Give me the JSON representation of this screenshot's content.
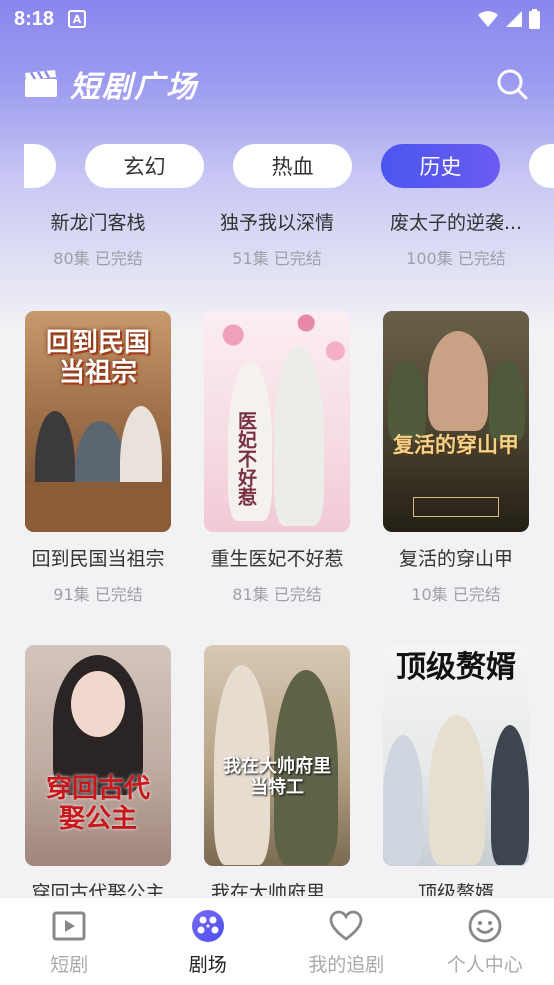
{
  "status": {
    "time": "8:18",
    "notif": "A"
  },
  "header": {
    "title": "短剧广场"
  },
  "chips": [
    "玄幻",
    "热血",
    "历史"
  ],
  "top_row": [
    {
      "title": "新龙门客栈",
      "meta": "80集 已完结"
    },
    {
      "title": "独予我以深情",
      "meta": "51集 已完结"
    },
    {
      "title": "废太子的逆袭...",
      "meta": "100集 已完结"
    }
  ],
  "row2": [
    {
      "title": "回到民国当祖宗",
      "meta": "91集 已完结",
      "poster_text": "回到民国\n当祖宗"
    },
    {
      "title": "重生医妃不好惹",
      "meta": "81集 已完结",
      "poster_text": "医妃不好惹"
    },
    {
      "title": "复活的穿山甲",
      "meta": "10集 已完结",
      "poster_text": "复活的穿山甲"
    }
  ],
  "row3": [
    {
      "title": "穿回古代娶公主",
      "meta": "",
      "poster_text": "穿回古代\n娶公主"
    },
    {
      "title": "我在大帅府里...",
      "meta": "",
      "poster_text": "我在大帅府里\n当特工"
    },
    {
      "title": "顶级赘婿",
      "meta": "",
      "poster_text": "顶级赘婿"
    }
  ],
  "nav": [
    {
      "label": "短剧",
      "icon": "play-square-icon"
    },
    {
      "label": "剧场",
      "icon": "theater-icon"
    },
    {
      "label": "我的追剧",
      "icon": "heart-icon"
    },
    {
      "label": "个人中心",
      "icon": "smiley-icon"
    }
  ],
  "colors": {
    "accent": "#5b57f0",
    "chip_active_start": "#4a56ee"
  }
}
